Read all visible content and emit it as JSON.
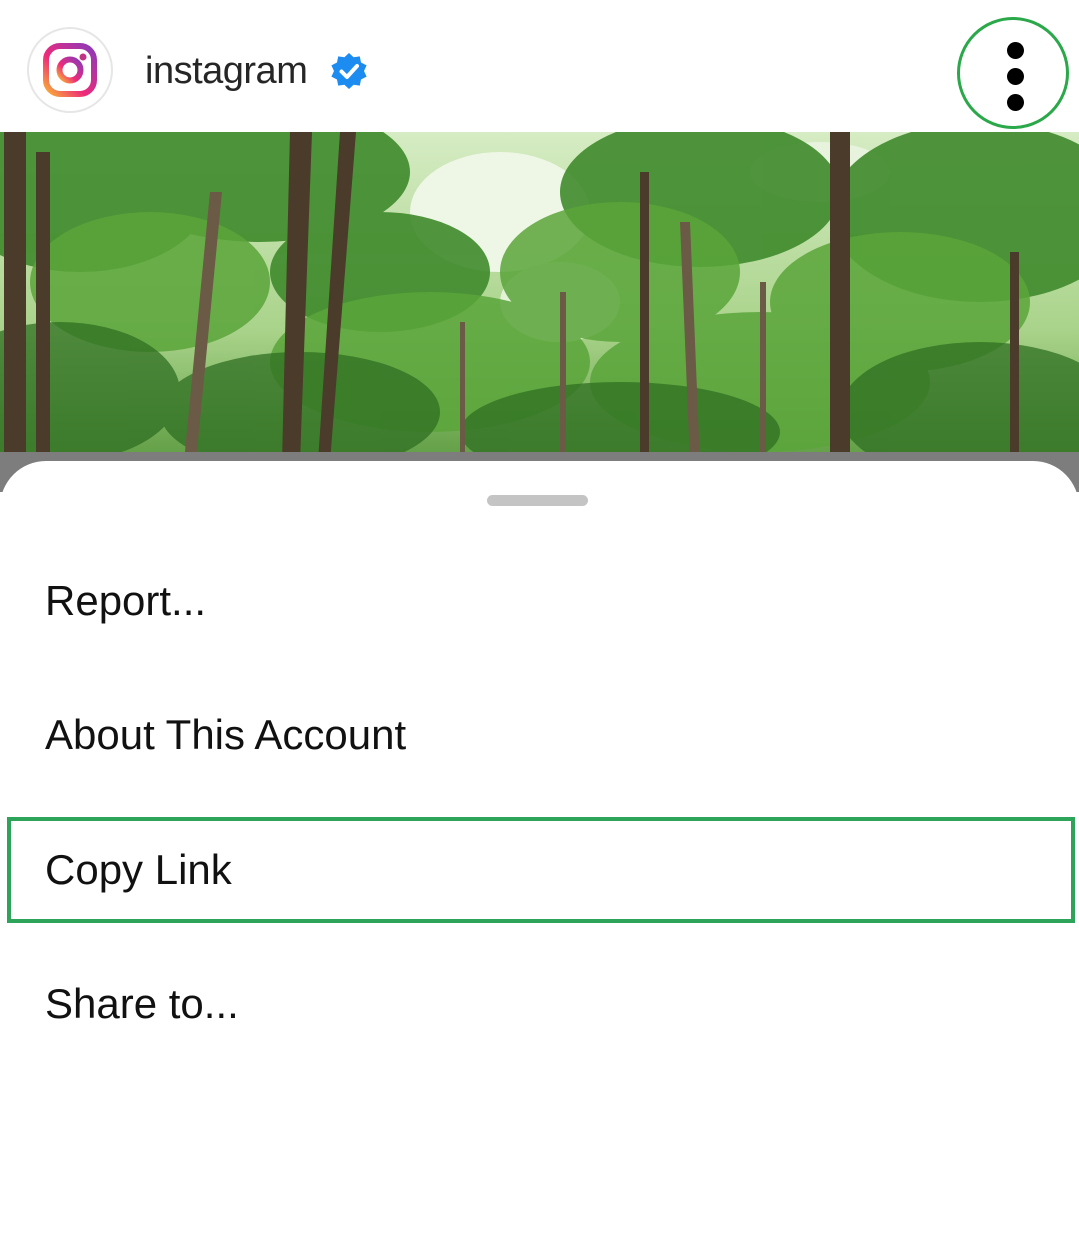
{
  "post_header": {
    "username": "instagram",
    "verified": true,
    "avatar_icon": "instagram-logo-icon",
    "more_icon": "more-vertical-icon"
  },
  "post": {
    "image_description": "forest canopy photo"
  },
  "sheet": {
    "items": [
      {
        "label": "Report..."
      },
      {
        "label": "About This Account"
      },
      {
        "label": "Copy Link",
        "highlighted": true
      },
      {
        "label": "Share to..."
      }
    ]
  },
  "colors": {
    "highlight": "#2ea35a",
    "verified": "#1d8cf0",
    "text": "#111111"
  }
}
